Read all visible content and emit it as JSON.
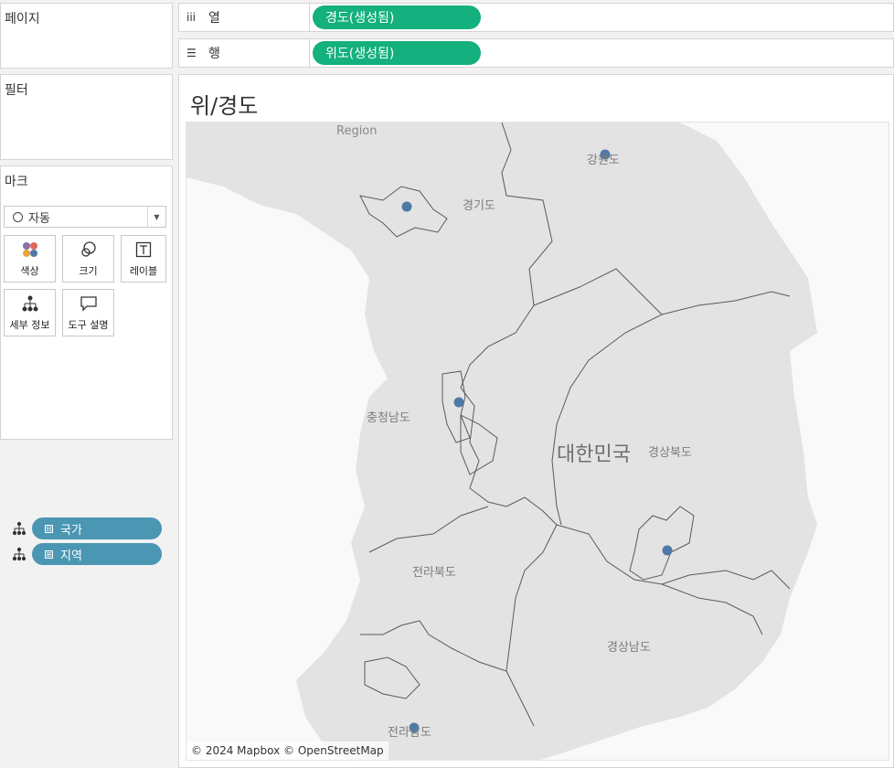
{
  "pages": {
    "title": "페이지"
  },
  "filters": {
    "title": "필터"
  },
  "marks": {
    "title": "마크",
    "mark_type": "자동",
    "buttons": {
      "color": "색상",
      "size": "크기",
      "label": "레이블",
      "detail": "세부 정보",
      "tooltip": "도구 설명"
    },
    "fields": [
      {
        "name": "국가",
        "expand": "⊟"
      },
      {
        "name": "지역",
        "expand": "⊞"
      }
    ]
  },
  "shelves": {
    "columns": {
      "label": "열",
      "pill": "경도(생성됨)"
    },
    "rows": {
      "label": "행",
      "pill": "위도(생성됨)"
    }
  },
  "view": {
    "title": "위/경도",
    "region_overlay": "Region",
    "country_label": "대한민국",
    "province_labels": [
      "강원도",
      "경기도",
      "충청남도",
      "경상북도",
      "전라북도",
      "경상남도",
      "전라남도"
    ],
    "attribution": "© 2024 Mapbox © OpenStreetMap"
  },
  "colors": {
    "measure_pill": "#14b07e",
    "dimension_pill": "#4a96b3",
    "mark": "#4e79a7",
    "land": "#e3e3e3",
    "border": "#5a5a5a"
  },
  "icons": {
    "columns": "columns-icon",
    "rows": "rows-icon",
    "hierarchy": "hierarchy-icon",
    "color": "color-dots-icon",
    "size": "size-circles-icon",
    "label": "text-label-icon",
    "detail": "detail-tree-icon",
    "tooltip": "speech-bubble-icon"
  }
}
